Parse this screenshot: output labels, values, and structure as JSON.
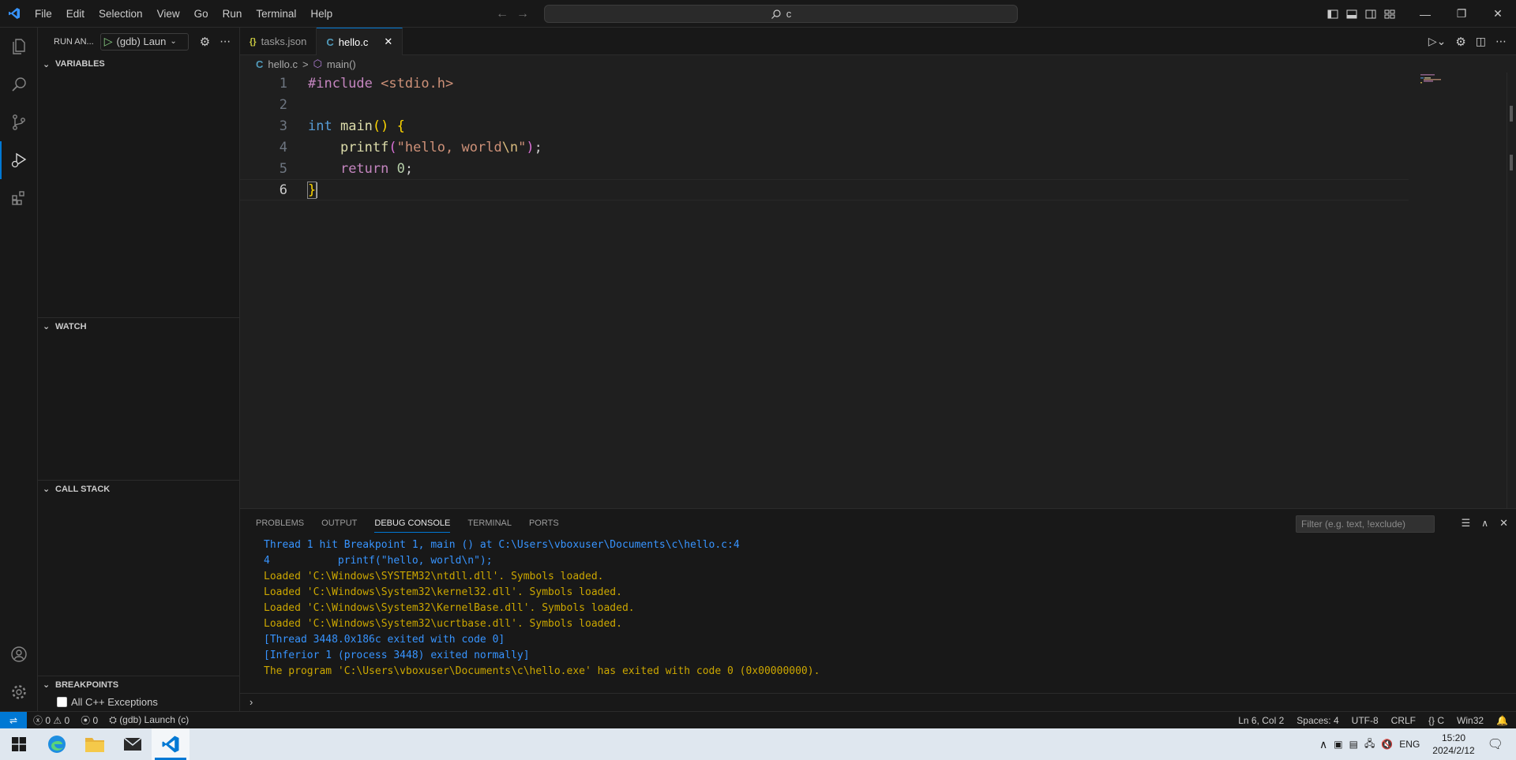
{
  "titlebar": {
    "menu": [
      "File",
      "Edit",
      "Selection",
      "View",
      "Go",
      "Run",
      "Terminal",
      "Help"
    ],
    "search_text": "c"
  },
  "sidebar": {
    "title": "RUN AN...",
    "config_name": "(gdb) Laun",
    "sections": {
      "variables": "VARIABLES",
      "watch": "WATCH",
      "call_stack": "CALL STACK",
      "breakpoints": "BREAKPOINTS"
    },
    "breakpoint_item": "All C++ Exceptions"
  },
  "tabs": [
    {
      "icon_text": "{}",
      "label": "tasks.json"
    },
    {
      "icon_text": "C",
      "label": "hello.c"
    }
  ],
  "breadcrumb": {
    "file_icon": "C",
    "file": "hello.c",
    "separator": ">",
    "symbol": "main()"
  },
  "editor": {
    "line_numbers": [
      "1",
      "2",
      "3",
      "4",
      "5",
      "6"
    ],
    "line1": {
      "pre": "#include",
      "header": "<stdio.h>"
    },
    "line3": {
      "type": "int",
      "fn": "main",
      "parens": "()",
      "brace": "{"
    },
    "line4": {
      "indent": "    ",
      "fn": "printf",
      "open": "(",
      "str1": "\"hello, world",
      "esc": "\\n",
      "str2": "\"",
      "close": ")",
      "semi": ";"
    },
    "line5": {
      "indent": "    ",
      "kw": "return",
      "num": "0",
      "semi": ";"
    },
    "line6": {
      "brace": "}"
    }
  },
  "panel": {
    "tabs": [
      "PROBLEMS",
      "OUTPUT",
      "DEBUG CONSOLE",
      "TERMINAL",
      "PORTS"
    ],
    "filter_placeholder": "Filter (e.g. text, !exclude)",
    "console_lines": [
      {
        "text": "Thread 1 hit Breakpoint 1, main () at C:\\Users\\vboxuser\\Documents\\c\\hello.c:4",
        "color": "blue"
      },
      {
        "text": "4           printf(\"hello, world\\n\");",
        "color": "blue"
      },
      {
        "text": "Loaded 'C:\\Windows\\SYSTEM32\\ntdll.dll'. Symbols loaded.",
        "color": "orange"
      },
      {
        "text": "Loaded 'C:\\Windows\\System32\\kernel32.dll'. Symbols loaded.",
        "color": "orange"
      },
      {
        "text": "Loaded 'C:\\Windows\\System32\\KernelBase.dll'. Symbols loaded.",
        "color": "orange"
      },
      {
        "text": "Loaded 'C:\\Windows\\System32\\ucrtbase.dll'. Symbols loaded.",
        "color": "orange"
      },
      {
        "text": "[Thread 3448.0x186c exited with code 0]",
        "color": "blue"
      },
      {
        "text": "[Inferior 1 (process 3448) exited normally]",
        "color": "blue"
      },
      {
        "text": "The program 'C:\\Users\\vboxuser\\Documents\\c\\hello.exe' has exited with code 0 (0x00000000).",
        "color": "orange"
      }
    ]
  },
  "statusbar": {
    "errors": "0",
    "warnings": "0",
    "ports": "0",
    "launch": "(gdb) Launch (c)",
    "position": "Ln 6, Col 2",
    "spaces": "Spaces: 4",
    "encoding": "UTF-8",
    "eol": "CRLF",
    "language": "C",
    "platform": "Win32"
  },
  "taskbar": {
    "lang": "ENG",
    "time": "15:20",
    "date": "2024/2/12"
  },
  "colors": {
    "accent": "#0078d4",
    "console_blue": "#3794ff",
    "console_orange": "#cca700"
  }
}
